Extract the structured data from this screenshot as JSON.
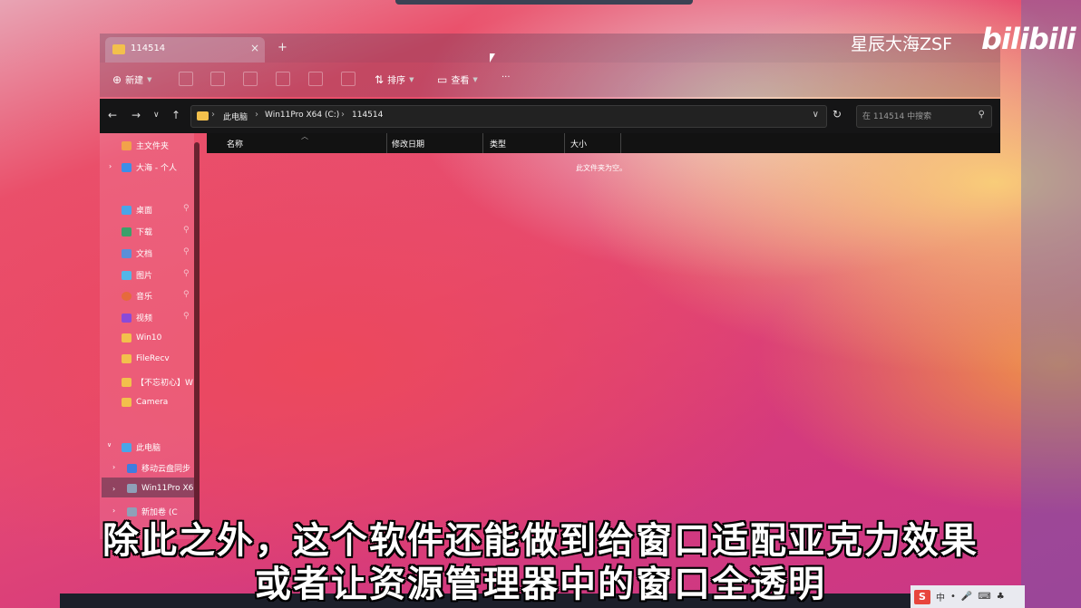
{
  "window": {
    "tab_title": "114514",
    "tab_close": "×",
    "tab_new": "+"
  },
  "commandbar": {
    "new_label": "新建",
    "sort_label": "排序",
    "view_label": "查看",
    "more_label": "···"
  },
  "address": {
    "crumbs": [
      "此电脑",
      "Win11Pro X64 (C:)",
      "114514"
    ],
    "separator": "›",
    "search_placeholder": "在 114514 中搜索"
  },
  "sidebar": {
    "items": [
      {
        "label": "主文件夹",
        "icon": "home-icon"
      },
      {
        "label": "大海 - 个人",
        "icon": "cloud-icon"
      },
      {
        "label": "桌面",
        "icon": "desktop-icon"
      },
      {
        "label": "下载",
        "icon": "download-icon"
      },
      {
        "label": "文档",
        "icon": "document-icon"
      },
      {
        "label": "图片",
        "icon": "picture-icon"
      },
      {
        "label": "音乐",
        "icon": "music-icon"
      },
      {
        "label": "视频",
        "icon": "video-icon"
      },
      {
        "label": "Win10",
        "icon": "folder-icon"
      },
      {
        "label": "FileRecv",
        "icon": "folder-icon"
      },
      {
        "label": "【不忘初心】W",
        "icon": "folder-icon"
      },
      {
        "label": "Camera",
        "icon": "folder-icon"
      },
      {
        "label": "此电脑",
        "icon": "computer-icon"
      },
      {
        "label": "移动云盘同步",
        "icon": "cloud-drive-icon"
      },
      {
        "label": "Win11Pro X6",
        "icon": "drive-icon"
      },
      {
        "label": "新加卷 (C",
        "icon": "drive-icon"
      }
    ]
  },
  "columns": {
    "name": "名称",
    "modified": "修改日期",
    "type": "类型",
    "size": "大小"
  },
  "empty_message": "此文件夹为空。",
  "watermark": {
    "author": "星辰大海ZSF",
    "logo": "bilibili"
  },
  "subtitles": {
    "line1": "除此之外，这个软件还能做到给窗口适配亚克力效果",
    "line2": "或者让资源管理器中的窗口全透明"
  },
  "tray": {
    "ime_logo": "S",
    "ime_mode": "中"
  },
  "colors": {
    "folder": "#f3c04c",
    "explorer_dark": "#151516"
  }
}
